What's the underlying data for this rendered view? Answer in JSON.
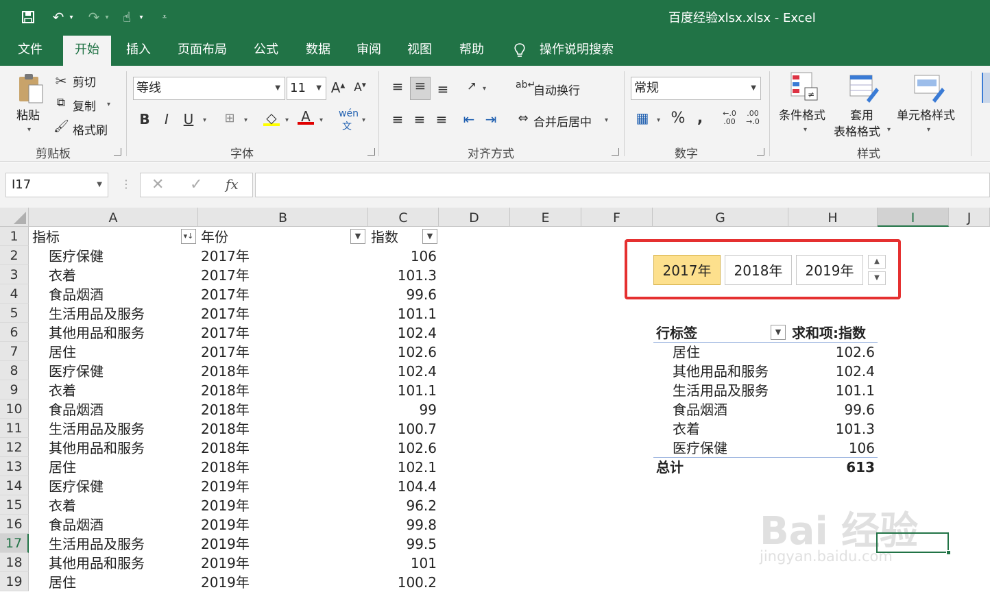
{
  "app": {
    "title": "百度经验xlsx.xlsx  -  Excel"
  },
  "tabs": [
    "文件",
    "开始",
    "插入",
    "页面布局",
    "公式",
    "数据",
    "审阅",
    "视图",
    "帮助"
  ],
  "tell_me": "操作说明搜索",
  "ribbon": {
    "clipboard": {
      "paste": "粘贴",
      "cut": "剪切",
      "copy": "复制",
      "format_painter": "格式刷",
      "group": "剪贴板"
    },
    "font": {
      "name": "等线",
      "size": "11",
      "group": "字体"
    },
    "alignment": {
      "wrap": "自动换行",
      "merge": "合并后居中",
      "group": "对齐方式"
    },
    "number": {
      "format": "常规",
      "group": "数字"
    },
    "styles": {
      "conditional": "条件格式",
      "table1": "套用",
      "table2": "表格格式",
      "cell_styles": "单元格样式",
      "group": "样式"
    }
  },
  "namebox": "I17",
  "columns": [
    "A",
    "B",
    "C",
    "D",
    "E",
    "F",
    "G",
    "H",
    "I",
    "J"
  ],
  "headers": {
    "a": "指标",
    "b": "年份",
    "c": "指数"
  },
  "rows": [
    {
      "a": "医疗保健",
      "b": "2017年",
      "c": "106"
    },
    {
      "a": "衣着",
      "b": "2017年",
      "c": "101.3"
    },
    {
      "a": "食品烟酒",
      "b": "2017年",
      "c": "99.6"
    },
    {
      "a": "生活用品及服务",
      "b": "2017年",
      "c": "101.1"
    },
    {
      "a": "其他用品和服务",
      "b": "2017年",
      "c": "102.4"
    },
    {
      "a": "居住",
      "b": "2017年",
      "c": "102.6"
    },
    {
      "a": "医疗保健",
      "b": "2018年",
      "c": "102.4"
    },
    {
      "a": "衣着",
      "b": "2018年",
      "c": "101.1"
    },
    {
      "a": "食品烟酒",
      "b": "2018年",
      "c": "99"
    },
    {
      "a": "生活用品及服务",
      "b": "2018年",
      "c": "100.7"
    },
    {
      "a": "其他用品和服务",
      "b": "2018年",
      "c": "102.6"
    },
    {
      "a": "居住",
      "b": "2018年",
      "c": "102.1"
    },
    {
      "a": "医疗保健",
      "b": "2019年",
      "c": "104.4"
    },
    {
      "a": "衣着",
      "b": "2019年",
      "c": "96.2"
    },
    {
      "a": "食品烟酒",
      "b": "2019年",
      "c": "99.8"
    },
    {
      "a": "生活用品及服务",
      "b": "2019年",
      "c": "99.5"
    },
    {
      "a": "其他用品和服务",
      "b": "2019年",
      "c": "101"
    },
    {
      "a": "居住",
      "b": "2019年",
      "c": "100.2"
    }
  ],
  "slicer": {
    "items": [
      "2017年",
      "2018年",
      "2019年"
    ],
    "selected": "2017年"
  },
  "pivot": {
    "row_label": "行标签",
    "value_label": "求和项:指数",
    "rows": [
      {
        "label": "居住",
        "value": "102.6"
      },
      {
        "label": "其他用品和服务",
        "value": "102.4"
      },
      {
        "label": "生活用品及服务",
        "value": "101.1"
      },
      {
        "label": "食品烟酒",
        "value": "99.6"
      },
      {
        "label": "衣着",
        "value": "101.3"
      },
      {
        "label": "医疗保健",
        "value": "106"
      }
    ],
    "total_label": "总计",
    "total_value": "613"
  },
  "watermark": {
    "brand": "Bai 经验",
    "url": "jingyan.baidu.com"
  },
  "colors": {
    "accent": "#217346",
    "slicer_selected": "#fde08d",
    "highlight_frame": "#e53030"
  }
}
